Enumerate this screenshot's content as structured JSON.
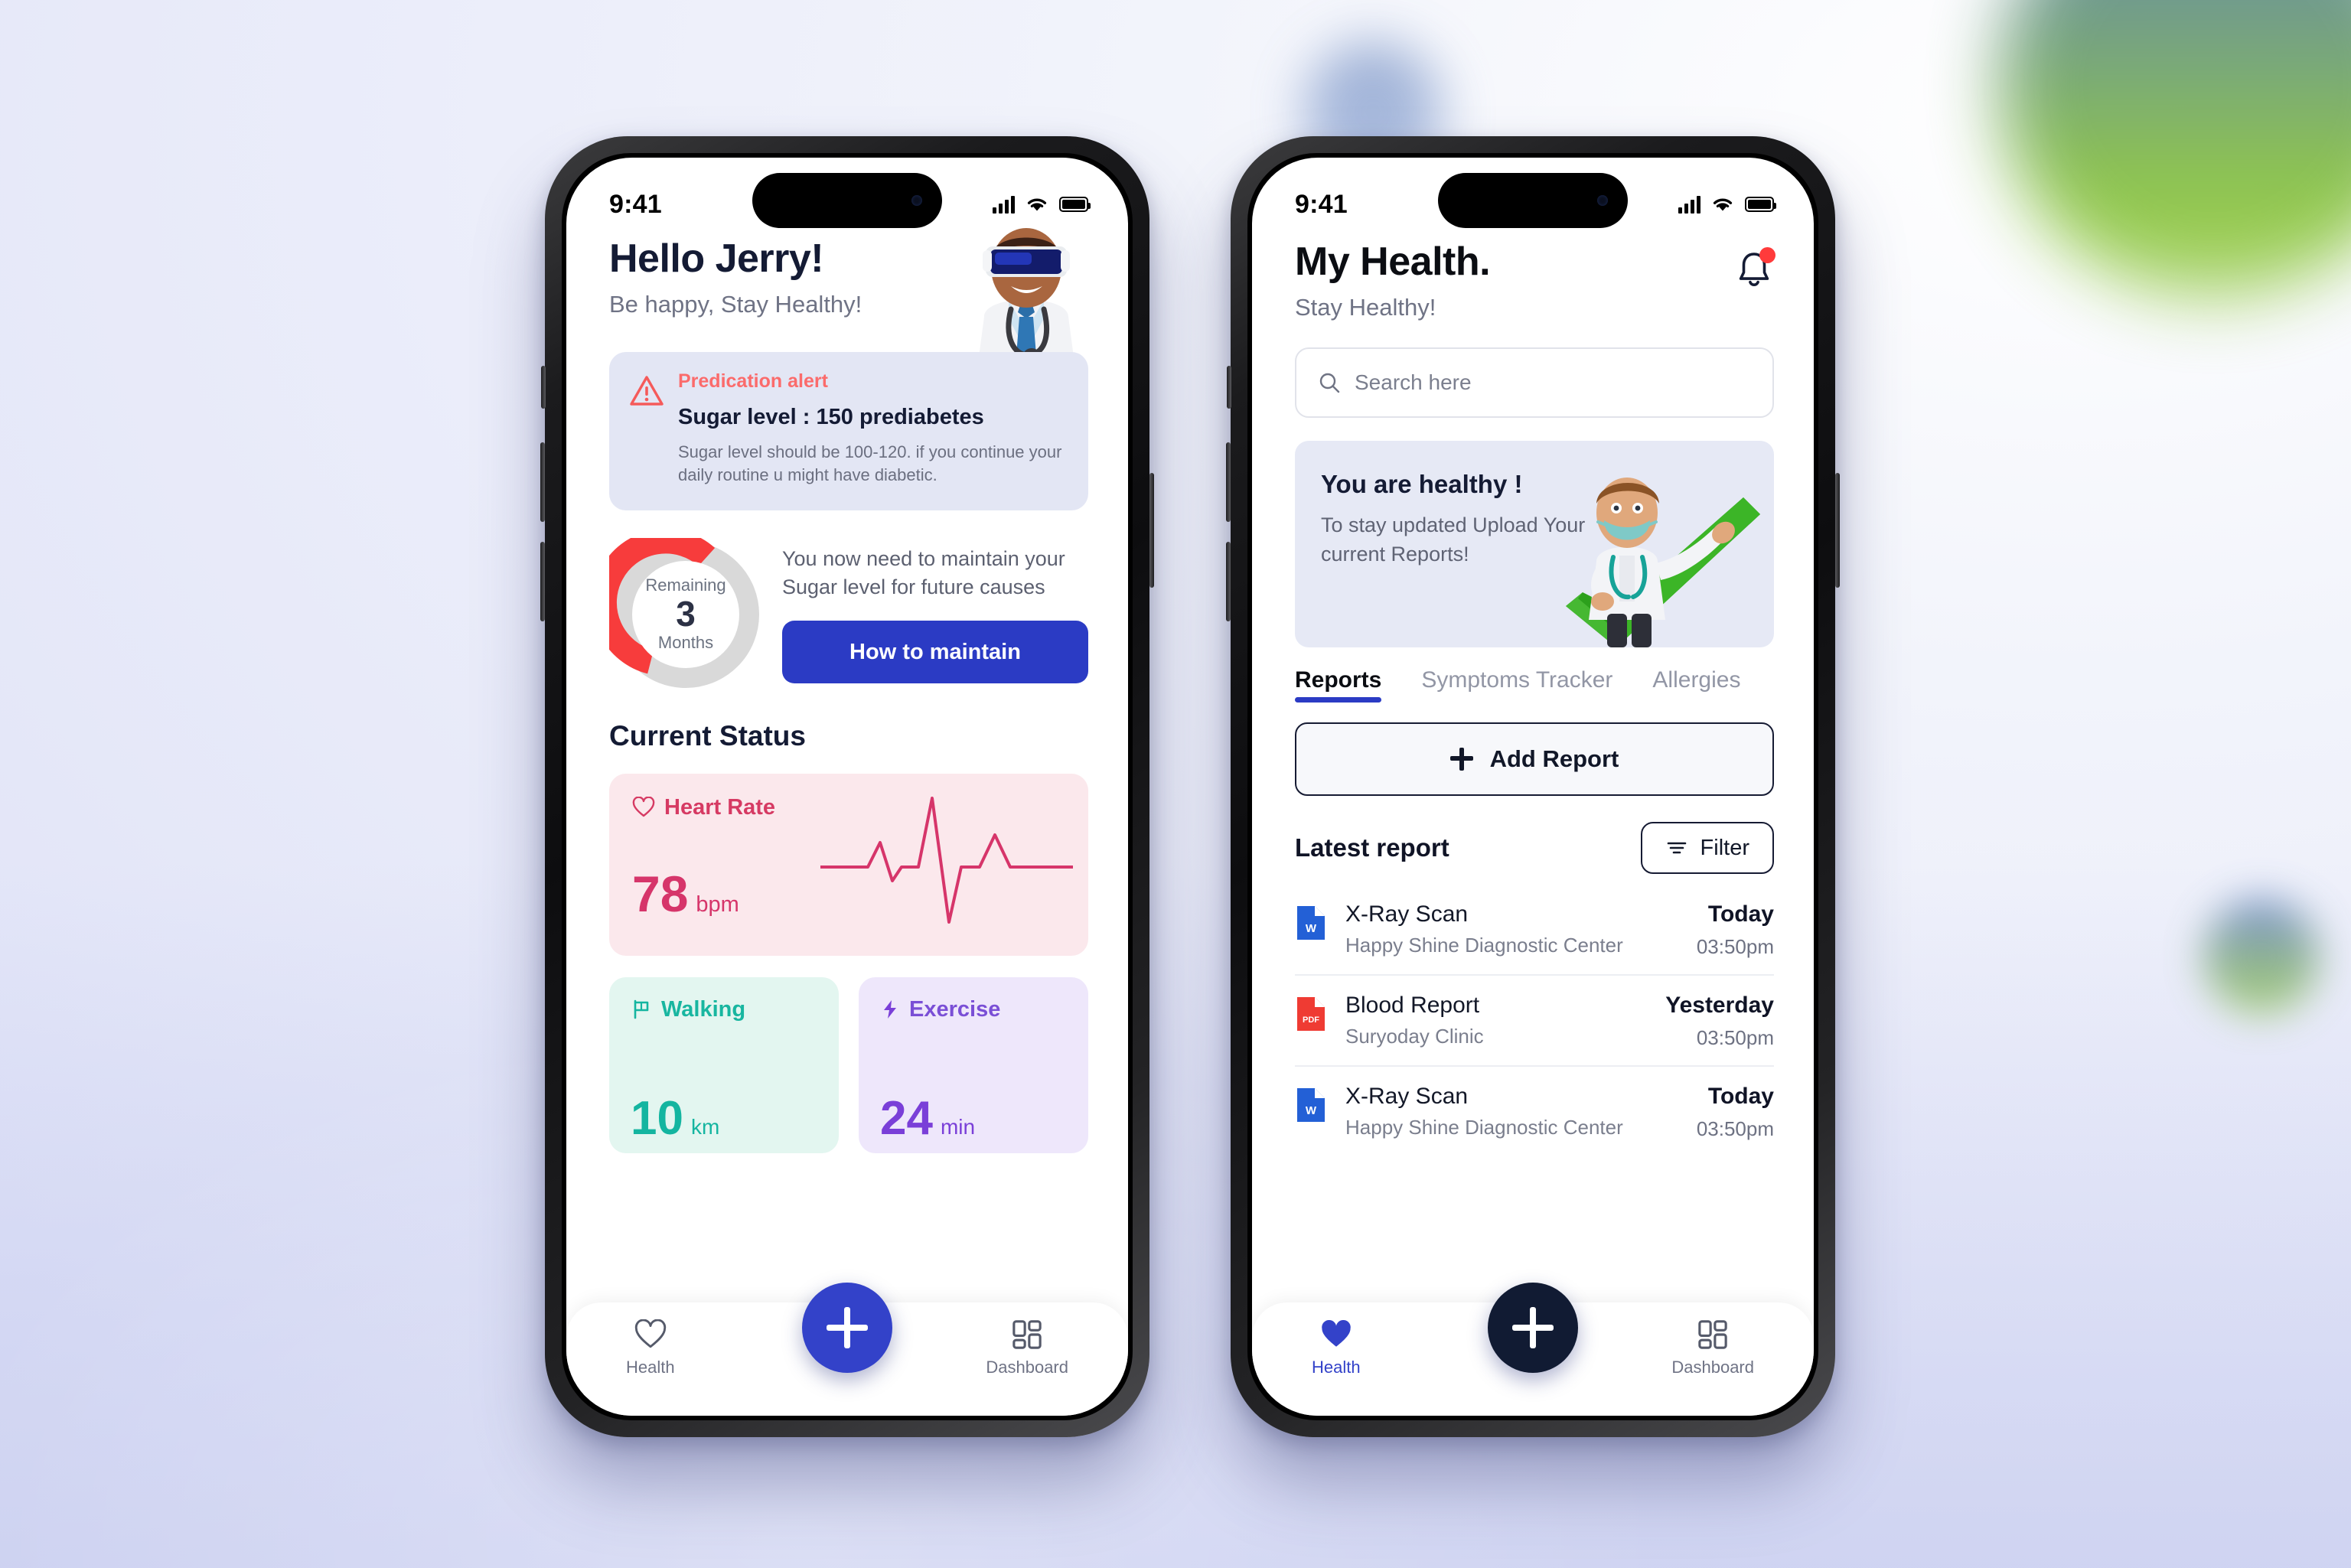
{
  "colors": {
    "primary_blue": "#2b3bc4",
    "dark_navy": "#111b33",
    "alert_red": "#fb6b6b",
    "heart_pink": "#d6356a",
    "walk_teal": "#14b5a0",
    "exercise_purple": "#7a3fd8",
    "donut_red": "#f73c3c",
    "donut_track": "#d8d8d8"
  },
  "phone1": {
    "status_bar": {
      "time": "9:41",
      "signal_icon": "cellular-signal-icon",
      "wifi_icon": "wifi-icon",
      "battery_icon": "battery-icon"
    },
    "header": {
      "greeting": "Hello Jerry!",
      "subtitle": "Be happy, Stay Healthy!",
      "illustration": "doctor-vr-headset-illustration"
    },
    "alert": {
      "icon": "warning-triangle-icon",
      "label": "Predication alert",
      "headline": "Sugar level : 150 prediabetes",
      "description": "Sugar level  should be  100-120. if you continue your daily routine u might have diabetic."
    },
    "remaining": {
      "label": "Remaining",
      "value": "3",
      "unit": "Months",
      "message": "You now need to maintain your Sugar level for future causes",
      "button_label": "How to maintain"
    },
    "current_status": {
      "title": "Current Status",
      "heart_rate": {
        "icon": "heart-outline-icon",
        "label": "Heart Rate",
        "value": "78",
        "unit": "bpm",
        "graph": "ecg-waveform"
      },
      "walking": {
        "icon": "flag-icon",
        "label": "Walking",
        "value": "10",
        "unit": "km"
      },
      "exercise": {
        "icon": "lightning-bolt-icon",
        "label": "Exercise",
        "value": "24",
        "unit": "min"
      }
    },
    "tabbar": {
      "left_icon": "heart-outline-icon",
      "left_label": "Health",
      "fab_icon": "plus-icon",
      "right_icon": "dashboard-grid-icon",
      "right_label": "Dashboard",
      "fab_color": "#3342c9"
    }
  },
  "phone2": {
    "status_bar": {
      "time": "9:41",
      "signal_icon": "cellular-signal-icon",
      "wifi_icon": "wifi-icon",
      "battery_icon": "battery-icon"
    },
    "header": {
      "title": "My Health.",
      "subtitle": "Stay Healthy!",
      "bell_icon": "bell-notification-icon"
    },
    "search": {
      "icon": "search-icon",
      "placeholder": "Search here",
      "value": ""
    },
    "banner": {
      "title": "You are healthy !",
      "description": "To stay updated Upload Your current Reports!",
      "illustration": "doctor-green-checkmark-illustration"
    },
    "tabs": [
      {
        "label": "Reports",
        "active": true
      },
      {
        "label": "Symptoms Tracker",
        "active": false
      },
      {
        "label": "Allergies",
        "active": false
      }
    ],
    "add_report": {
      "icon": "plus-icon",
      "label": "Add Report"
    },
    "latest": {
      "title": "Latest report",
      "filter_icon": "filter-icon",
      "filter_label": "Filter"
    },
    "reports": [
      {
        "file_type": "word-document-icon",
        "name": "X-Ray Scan",
        "place": "Happy Shine Diagnostic Center",
        "day": "Today",
        "time": "03:50pm"
      },
      {
        "file_type": "pdf-document-icon",
        "name": "Blood Report",
        "place": "Suryoday Clinic",
        "day": "Yesterday",
        "time": "03:50pm"
      },
      {
        "file_type": "word-document-icon",
        "name": "X-Ray Scan",
        "place": "Happy Shine Diagnostic Center",
        "day": "Today",
        "time": "03:50pm"
      }
    ],
    "tabbar": {
      "left_icon": "heart-filled-icon",
      "left_label": "Health",
      "fab_icon": "plus-icon",
      "right_icon": "dashboard-grid-icon",
      "right_label": "Dashboard",
      "fab_color": "#111b33"
    }
  }
}
